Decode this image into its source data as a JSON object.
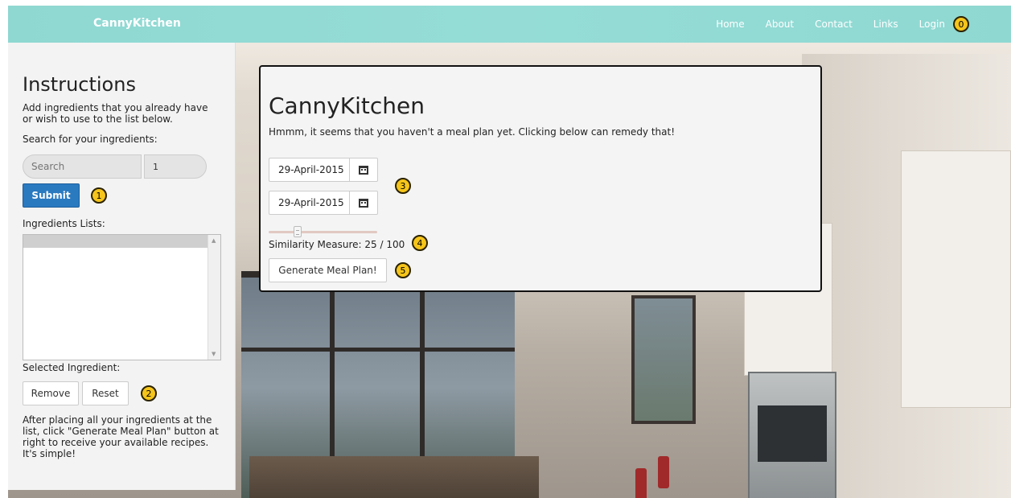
{
  "navbar": {
    "brand": "CannyKitchen",
    "links": [
      "Home",
      "About",
      "Contact",
      "Links",
      "Login"
    ],
    "annotation": "0"
  },
  "sidebar": {
    "title": "Instructions",
    "intro": "Add ingredients that you already have or wish to use to the list below.",
    "search_label": "Search for your ingredients:",
    "search_placeholder": "Search",
    "quantity_value": "1",
    "submit_label": "Submit",
    "submit_annotation": "1",
    "lists_label": "Ingredients Lists:",
    "selected_label": "Selected Ingredient:",
    "remove_label": "Remove",
    "reset_label": "Reset",
    "buttons_annotation": "2",
    "outro": "After placing all your ingredients at the list, click \"Generate Meal Plan\" button at right to receive your available recipes. It's simple!"
  },
  "panel": {
    "title": "CannyKitchen",
    "subtitle": "Hmmm, it seems that you haven't a meal plan yet. Clicking below can remedy that!",
    "start_date": "29-April-2015",
    "end_date": "29-April-2015",
    "dates_annotation": "3",
    "similarity_value": 25,
    "similarity_max": 100,
    "similarity_label": "Similarity Measure: 25 / 100",
    "similarity_annotation": "4",
    "generate_label": "Generate Meal Plan!",
    "generate_annotation": "5"
  },
  "colors": {
    "navbar": "#95dcd6",
    "submit": "#2a7ac0",
    "annotation_badge": "#f6c51b"
  },
  "icons": {
    "calendar": "calendar-icon"
  }
}
